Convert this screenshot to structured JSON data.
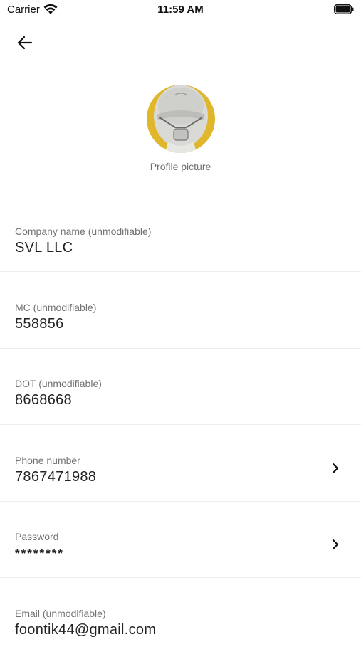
{
  "status_bar": {
    "carrier": "Carrier",
    "time": "11:59 AM",
    "wifi_icon": "wifi-icon",
    "battery_icon": "battery-icon"
  },
  "header": {
    "back_icon": "arrow-left-icon"
  },
  "profile": {
    "caption": "Profile picture",
    "accent_color": "#e0b62a"
  },
  "fields": [
    {
      "label": "Company name (unmodifiable)",
      "value": "SVL LLC"
    },
    {
      "label": "MC (unmodifiable)",
      "value": "558856"
    },
    {
      "label": "DOT (unmodifiable)",
      "value": "8668668"
    },
    {
      "label": "Phone number",
      "value": "7867471988",
      "chevron_icon": "chevron-right-icon"
    },
    {
      "label": "Password",
      "value": "********",
      "chevron_icon": "chevron-right-icon"
    },
    {
      "label": "Email (unmodifiable)",
      "value": "foontik44@gmail.com"
    }
  ]
}
